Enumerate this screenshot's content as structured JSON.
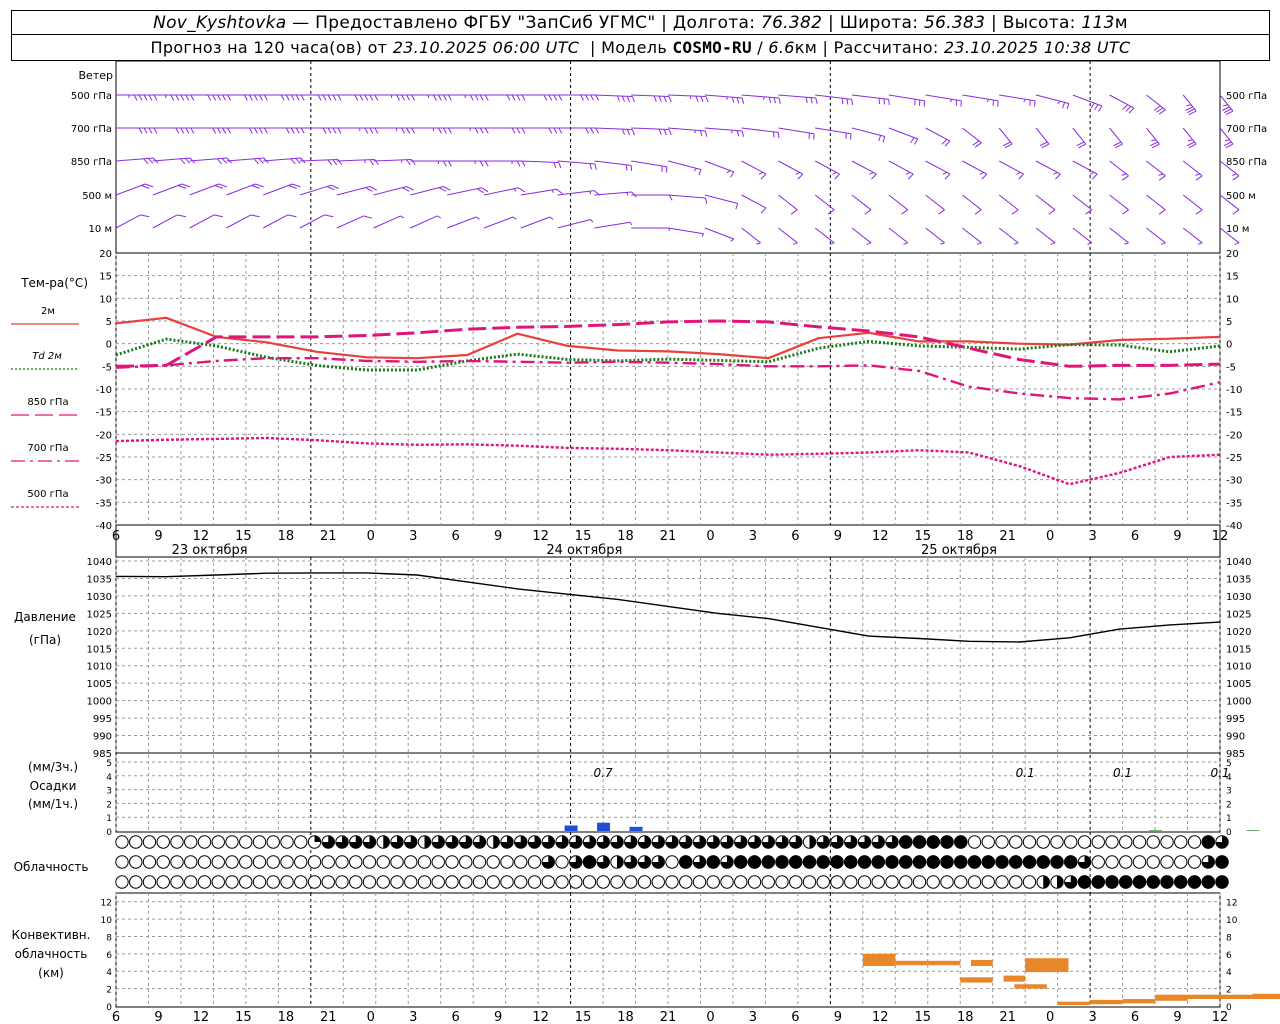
{
  "header": {
    "station": "Nov_Kyshtovka",
    "provider": "Предоставлено ФГБУ \"ЗапСиб УГМС\"",
    "lon_label": "Долгота:",
    "lon": "76.382",
    "lat_label": "Широта:",
    "lat": "56.383",
    "alt_label": "Высота:",
    "alt": "113",
    "alt_unit": "м",
    "forecast_label": "Прогноз на 120 часа(ов) от",
    "forecast_from": "23.10.2025 06:00 UTC",
    "model_label": "Модель",
    "model": "COSMO-RU",
    "model_res": "6.6",
    "model_res_unit": "км",
    "calc_label": "Рассчитано:",
    "calc_time": "23.10.2025 10:38 UTC"
  },
  "colors": {
    "wind": "#8a2be2",
    "t2m": "#e8403c",
    "td2m": "#1a7a1a",
    "t850": "#e0147a",
    "t700": "#e0147a",
    "t500": "#e0147a",
    "pressure": "#000000",
    "precip": "#1f4fd8",
    "convective": "#e8862a",
    "grid": "#9a9a9a"
  },
  "chart_data": [
    {
      "type": "barbs",
      "title": "Ветер",
      "levels": [
        "500 гПа",
        "700 гПа",
        "850 гПа",
        "500 м",
        "10 м"
      ],
      "level_keys": [
        "p500",
        "p700",
        "p850",
        "h500",
        "h10"
      ],
      "wind_dir_deg": {
        "p500": [
          270,
          270,
          270,
          270,
          270,
          270,
          270,
          270,
          270,
          270,
          270,
          270,
          270,
          275,
          275,
          275,
          280,
          280,
          280,
          285,
          285,
          290,
          290,
          290,
          290,
          300,
          310,
          320,
          330,
          340,
          340
        ],
        "p700": [
          270,
          270,
          270,
          270,
          270,
          270,
          270,
          270,
          270,
          270,
          270,
          270,
          270,
          275,
          275,
          280,
          280,
          285,
          290,
          290,
          300,
          310,
          320,
          330,
          340,
          340,
          340,
          340,
          340,
          340,
          340
        ],
        "p850": [
          260,
          260,
          260,
          260,
          260,
          265,
          265,
          265,
          270,
          270,
          270,
          275,
          280,
          285,
          290,
          300,
          310,
          320,
          320,
          320,
          320,
          320,
          320,
          320,
          320,
          320,
          320,
          330,
          330,
          330,
          330
        ],
        "h500": [
          230,
          230,
          230,
          230,
          230,
          235,
          240,
          240,
          240,
          245,
          245,
          250,
          255,
          260,
          270,
          280,
          300,
          320,
          330,
          330,
          330,
          330,
          330,
          330,
          330,
          330,
          330,
          330,
          330,
          330,
          330
        ],
        "h10": [
          220,
          220,
          220,
          220,
          220,
          220,
          225,
          225,
          225,
          230,
          230,
          230,
          240,
          250,
          270,
          290,
          310,
          330,
          330,
          330,
          330,
          330,
          330,
          330,
          330,
          330,
          330,
          330,
          330,
          330,
          330
        ]
      },
      "wind_speed_ms": {
        "p500": [
          28,
          28,
          27,
          26,
          26,
          25,
          25,
          24,
          24,
          23,
          22,
          22,
          21,
          20,
          20,
          19,
          18,
          18,
          17,
          16,
          15,
          15,
          14,
          14,
          14,
          14,
          15,
          16,
          17,
          18,
          18
        ],
        "p700": [
          22,
          22,
          21,
          21,
          20,
          20,
          19,
          19,
          18,
          18,
          17,
          17,
          16,
          15,
          15,
          14,
          13,
          12,
          12,
          11,
          11,
          10,
          10,
          10,
          10,
          11,
          12,
          12,
          13,
          13,
          13
        ],
        "p850": [
          16,
          16,
          16,
          15,
          15,
          15,
          14,
          14,
          14,
          13,
          13,
          12,
          12,
          11,
          10,
          9,
          8,
          8,
          8,
          8,
          8,
          8,
          8,
          8,
          8,
          9,
          9,
          9,
          9,
          9,
          9
        ],
        "h500": [
          12,
          12,
          12,
          12,
          11,
          11,
          11,
          10,
          10,
          10,
          9,
          9,
          9,
          8,
          7,
          6,
          6,
          6,
          6,
          6,
          6,
          6,
          6,
          6,
          6,
          6,
          6,
          6,
          6,
          6,
          6
        ],
        "h10": [
          5,
          5,
          5,
          5,
          5,
          5,
          5,
          4,
          4,
          4,
          4,
          4,
          4,
          3,
          3,
          3,
          3,
          3,
          3,
          3,
          3,
          3,
          3,
          3,
          3,
          3,
          3,
          3,
          3,
          3,
          3
        ]
      }
    },
    {
      "type": "line",
      "ylabel": "Тем-ра(°С)",
      "ylim": [
        -40,
        20
      ],
      "yticks": [
        -40,
        -35,
        -30,
        -25,
        -20,
        -15,
        -10,
        -5,
        0,
        5,
        10,
        15,
        20
      ],
      "series": [
        {
          "name": "2м",
          "key": "t2m",
          "style": "solid",
          "values": [
            4.5,
            5.7,
            1.5,
            0.3,
            -1.8,
            -3,
            -3.2,
            -2.5,
            2.2,
            -0.5,
            -1.5,
            -1.7,
            -2.3,
            -3.2,
            1.2,
            2.4,
            0.5,
            0.5,
            0,
            -0.2,
            0.8,
            1.1,
            1.5
          ]
        },
        {
          "name": "Td 2м",
          "key": "td2m",
          "style": "dotted",
          "values": [
            -2.5,
            1,
            -0.5,
            -3,
            -4.8,
            -5.8,
            -5.8,
            -3.8,
            -2.3,
            -3.5,
            -3.8,
            -3.4,
            -3.7,
            -4,
            -1,
            0.5,
            -0.5,
            -0.8,
            -1.2,
            -0.2,
            -0.3,
            -1.8,
            -0.5
          ]
        },
        {
          "name": "850 гПа",
          "key": "t850",
          "style": "longdash",
          "values": [
            -5,
            -4.8,
            1.5,
            1.5,
            1.5,
            1.8,
            2.4,
            3.2,
            3.6,
            3.8,
            4.2,
            4.8,
            5,
            4.8,
            3.7,
            2.8,
            1.5,
            -1,
            -3.5,
            -5,
            -4.8,
            -4.8,
            -4.5
          ]
        },
        {
          "name": "700 гПа",
          "key": "t700",
          "style": "dashdot",
          "values": [
            -5.3,
            -4.8,
            -3.8,
            -3.2,
            -3.2,
            -3.8,
            -4,
            -3.8,
            -4,
            -4.2,
            -4,
            -4.2,
            -4.5,
            -5,
            -5,
            -4.8,
            -6,
            -9.5,
            -11,
            -12,
            -12.3,
            -11,
            -8.5
          ]
        },
        {
          "name": "500 гПа",
          "key": "t500",
          "style": "shortdash",
          "values": [
            -21.5,
            -21.2,
            -21,
            -20.8,
            -21.3,
            -22,
            -22.3,
            -22.2,
            -22.5,
            -23,
            -23.2,
            -23.5,
            -24,
            -24.5,
            -24.3,
            -24,
            -23.5,
            -24,
            -27,
            -31,
            -28.5,
            -25,
            -24.5
          ]
        }
      ]
    },
    {
      "type": "line",
      "ylabel": "Давление",
      "yunit": "(гПа)",
      "ylim": [
        985,
        1040
      ],
      "yticks": [
        985,
        990,
        995,
        1000,
        1005,
        1010,
        1015,
        1020,
        1025,
        1030,
        1035,
        1040
      ],
      "series": [
        {
          "name": "",
          "key": "pressure",
          "style": "solid",
          "values": [
            1035.6,
            1035.5,
            1036.0,
            1036.5,
            1036.6,
            1036.6,
            1036.0,
            1034.0,
            1032.0,
            1030.5,
            1029.0,
            1027.0,
            1025.0,
            1023.5,
            1021.0,
            1018.5,
            1017.8,
            1017.0,
            1016.8,
            1018.0,
            1020.5,
            1021.7,
            1022.5
          ]
        }
      ]
    },
    {
      "type": "bar",
      "ylabel": "Осадки",
      "yunit_top": "(мм/3ч.)",
      "yunit_bottom": "(мм/1ч.)",
      "ylim": [
        0,
        5
      ],
      "yticks": [
        0,
        1,
        2,
        3,
        4,
        5
      ],
      "bars": [
        {
          "h": 42,
          "value": 0.4
        },
        {
          "h": 45,
          "value": 0.6
        },
        {
          "h": 48,
          "value": 0.3
        },
        {
          "h": 96,
          "value": 0.05
        },
        {
          "h": 105,
          "value": 0.05
        },
        {
          "h": 114,
          "value": 0.05
        }
      ],
      "labels": [
        {
          "h": 45,
          "text": "0.7"
        },
        {
          "h": 84,
          "text": "0.1"
        },
        {
          "h": 93,
          "text": "0.1"
        },
        {
          "h": 102,
          "text": "0.1"
        }
      ]
    },
    {
      "type": "table",
      "ylabel": "Облачность",
      "note": "symbols: 0=clear,1=quarter,2=half,3=three-quarters,4=overcast; 3 tiers (high, middle, low), 3-hourly",
      "rows": {
        "high": [
          0,
          0,
          0,
          0,
          0,
          0,
          0,
          0,
          0,
          0,
          0,
          0,
          0,
          0,
          0,
          0,
          0,
          0,
          1,
          2,
          3,
          3,
          3,
          3,
          3,
          2,
          3,
          3,
          3,
          2,
          3,
          3,
          3,
          3,
          3,
          2,
          3,
          3,
          3,
          3,
          3,
          3,
          3,
          3,
          3,
          3,
          3,
          3,
          3,
          3,
          3,
          3,
          3,
          3,
          3,
          3,
          3,
          3,
          3,
          3,
          3,
          3,
          3,
          3,
          3,
          2,
          3,
          2,
          3,
          3,
          3,
          2,
          3,
          3,
          4,
          4,
          4,
          4,
          4,
          4,
          0,
          0,
          0,
          0,
          0,
          0,
          0,
          0,
          0,
          0,
          0,
          0,
          0,
          0,
          0,
          0,
          0,
          0,
          0,
          0,
          0,
          0,
          0,
          4,
          3
        ],
        "middle": [
          0,
          0,
          0,
          0,
          0,
          0,
          0,
          0,
          0,
          0,
          0,
          0,
          0,
          0,
          0,
          0,
          0,
          0,
          0,
          0,
          0,
          0,
          0,
          0,
          0,
          0,
          0,
          0,
          0,
          0,
          0,
          0,
          0,
          0,
          0,
          0,
          0,
          0,
          0,
          0,
          0,
          0,
          0,
          0,
          0,
          3,
          4,
          0,
          3,
          3,
          4,
          3,
          3,
          2,
          3,
          3,
          3,
          3,
          4,
          0,
          4,
          3,
          4,
          4,
          3,
          3,
          4,
          4,
          4,
          4,
          4,
          4,
          4,
          4,
          4,
          4,
          4,
          4,
          4,
          4,
          4,
          4,
          4,
          4,
          4,
          4,
          4,
          4,
          4,
          4,
          4,
          4,
          4,
          4,
          4,
          4,
          4,
          4,
          4,
          4,
          3,
          4,
          3,
          2,
          0,
          0,
          0,
          0,
          0,
          0,
          0,
          0,
          0,
          0,
          0,
          0,
          3,
          4
        ],
        "low": [
          0,
          0,
          0,
          0,
          0,
          0,
          0,
          0,
          0,
          0,
          0,
          0,
          0,
          0,
          0,
          0,
          0,
          0,
          0,
          0,
          0,
          0,
          0,
          0,
          0,
          0,
          0,
          0,
          0,
          0,
          0,
          0,
          0,
          0,
          0,
          0,
          0,
          0,
          0,
          0,
          0,
          0,
          0,
          0,
          0,
          0,
          0,
          0,
          0,
          0,
          0,
          0,
          0,
          0,
          0,
          0,
          0,
          0,
          0,
          0,
          0,
          0,
          0,
          0,
          0,
          0,
          0,
          0,
          0,
          0,
          0,
          0,
          0,
          0,
          0,
          0,
          0,
          0,
          0,
          0,
          0,
          0,
          0,
          0,
          0,
          0,
          0,
          0,
          0,
          0,
          0,
          0,
          0,
          0,
          0,
          0,
          0,
          0,
          0,
          0,
          0,
          0,
          0,
          0,
          0,
          2,
          2,
          1,
          3,
          4,
          4,
          4,
          4,
          4,
          4,
          4,
          4,
          4,
          4,
          4,
          4,
          4,
          4,
          4,
          4,
          4
        ]
      }
    },
    {
      "type": "bar",
      "ylabel_lines": [
        "Конвективн.",
        "облачность",
        "(км)"
      ],
      "ylim": [
        0,
        13
      ],
      "yticks": [
        0,
        2,
        4,
        6,
        8,
        10,
        12
      ],
      "blocks": [
        {
          "h0": 69,
          "h1": 72,
          "bottom": 4.6,
          "top": 6.0
        },
        {
          "h0": 72,
          "h1": 75,
          "bottom": 4.7,
          "top": 5.2
        },
        {
          "h0": 75,
          "h1": 78,
          "bottom": 4.7,
          "top": 5.2
        },
        {
          "h0": 78,
          "h1": 81,
          "bottom": 2.7,
          "top": 3.3
        },
        {
          "h0": 79,
          "h1": 81,
          "bottom": 4.6,
          "top": 5.3
        },
        {
          "h0": 82,
          "h1": 84,
          "bottom": 2.8,
          "top": 3.5
        },
        {
          "h0": 83,
          "h1": 86,
          "bottom": 2.0,
          "top": 2.5
        },
        {
          "h0": 84,
          "h1": 88,
          "bottom": 3.9,
          "top": 5.5
        },
        {
          "h0": 87,
          "h1": 90,
          "bottom": 0.1,
          "top": 0.5
        },
        {
          "h0": 90,
          "h1": 93,
          "bottom": 0.2,
          "top": 0.7
        },
        {
          "h0": 93,
          "h1": 96,
          "bottom": 0.3,
          "top": 0.8
        },
        {
          "h0": 96,
          "h1": 99,
          "bottom": 0.6,
          "top": 1.3
        },
        {
          "h0": 99,
          "h1": 102,
          "bottom": 0.8,
          "top": 1.3
        },
        {
          "h0": 102,
          "h1": 105,
          "bottom": 0.8,
          "top": 1.3
        },
        {
          "h0": 105,
          "h1": 108,
          "bottom": 0.8,
          "top": 1.4
        }
      ]
    }
  ],
  "time_axis": {
    "hours_offset_start": 0,
    "hours_span": 102,
    "tick_labels": [
      "6",
      "9",
      "12",
      "15",
      "18",
      "21",
      "0",
      "3",
      "6",
      "9",
      "12",
      "15",
      "18",
      "21",
      "0",
      "3",
      "6",
      "9",
      "12",
      "15",
      "18",
      "21",
      "0",
      "3",
      "6",
      "9",
      "12"
    ],
    "day_labels": [
      {
        "hour": 24,
        "text": "23 октября"
      },
      {
        "hour": 48,
        "text": "24 октября"
      },
      {
        "hour": 72,
        "text": "25 октября"
      }
    ],
    "midnight_hours": [
      18,
      42,
      66,
      90
    ]
  }
}
